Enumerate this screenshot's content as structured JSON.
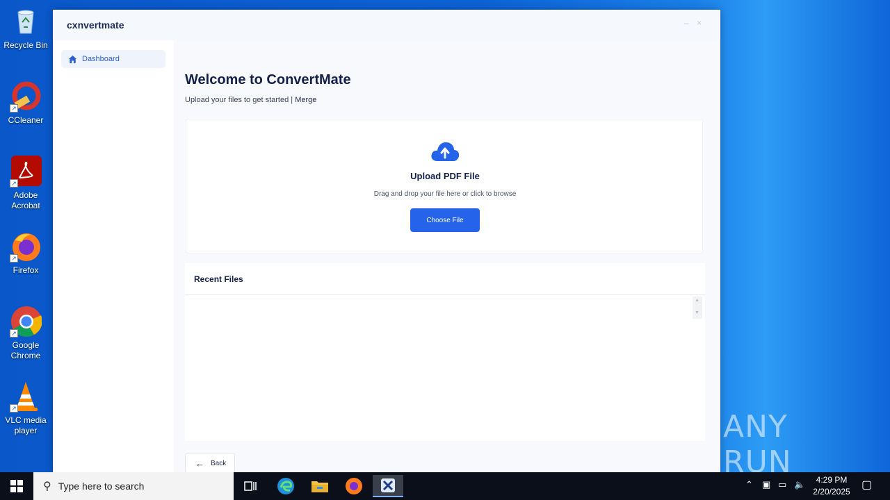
{
  "desktop": {
    "icons": [
      {
        "label": "Recycle Bin"
      },
      {
        "label": "CCleaner"
      },
      {
        "label": "Adobe Acrobat"
      },
      {
        "label": "Firefox"
      },
      {
        "label": "Google Chrome"
      },
      {
        "label": "VLC media player"
      }
    ],
    "watermark": "ANY RUN"
  },
  "app": {
    "logo": "cxnvertmate",
    "window_controls": {
      "minimize": "–",
      "close": "×"
    },
    "sidebar": {
      "items": [
        {
          "label": "Dashboard",
          "icon": "home-icon"
        }
      ]
    },
    "main": {
      "title": "Welcome to ConvertMate",
      "subtitle": "Upload your files to get started",
      "separator": "|",
      "mode": "Merge",
      "upload": {
        "title": "Upload PDF File",
        "hint": "Drag and drop your file here or click to browse",
        "button": "Choose File"
      },
      "recent": {
        "title": "Recent Files"
      },
      "back_button": "Back"
    },
    "colors": {
      "accent": "#2563eb",
      "heading": "#14204a"
    }
  },
  "taskbar": {
    "search_placeholder": "Type here to search",
    "time": "4:29 PM",
    "date": "2/20/2025"
  }
}
